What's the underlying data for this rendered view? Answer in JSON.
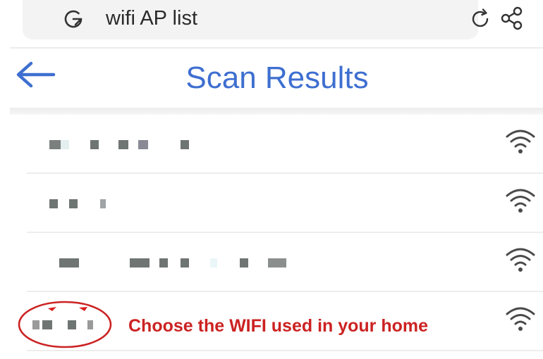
{
  "search": {
    "query": "wifi AP list"
  },
  "header": {
    "title": "Scan Results"
  },
  "scan_results": [
    {
      "name": "",
      "signal": "full"
    },
    {
      "name": "",
      "signal": "full"
    },
    {
      "name": "",
      "signal": "full"
    },
    {
      "name": "",
      "signal": "full"
    }
  ],
  "annotation": {
    "hint": "Choose the WIFI used in your home",
    "color": "#cc2222"
  },
  "colors": {
    "accent": "#3e6fd0",
    "wifi_icon": "#4a4a4a"
  }
}
